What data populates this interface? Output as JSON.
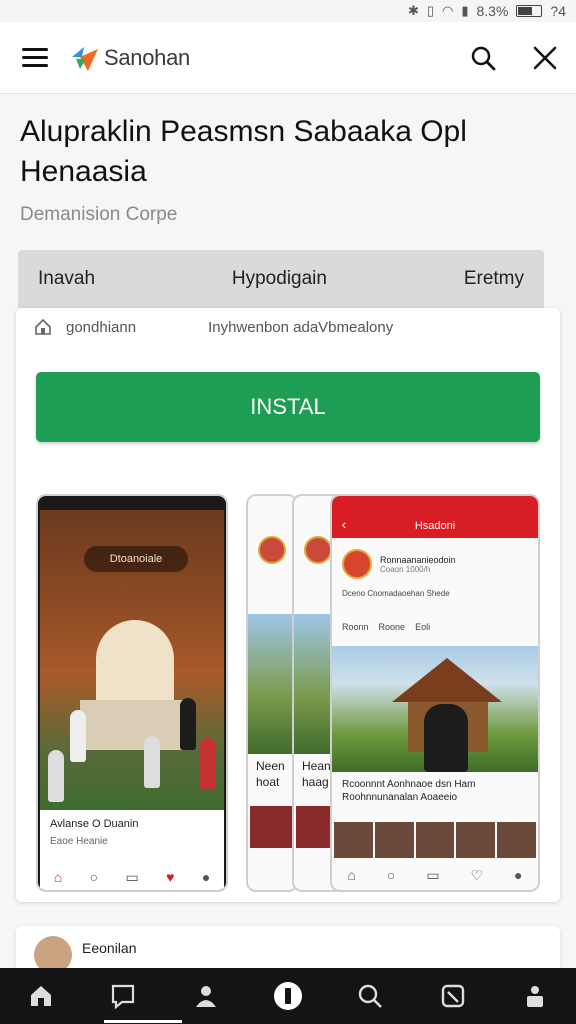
{
  "status_bar": {
    "battery": "8.3%",
    "time": "?4"
  },
  "header": {
    "brand": "Sanohan"
  },
  "app": {
    "title": "Alupraklin Peasmsn Sabaaka Opl Henaasia",
    "developer": "Demanision Corpe"
  },
  "tabs": [
    "Inavah",
    "Hypodigain",
    "Eretmy"
  ],
  "info": {
    "left": "gondhiann",
    "right": "Inyhwenbon adaVbmealony"
  },
  "install_label": "INSTAL",
  "screenshots": {
    "s1": {
      "badge": "Dtoanoiale",
      "caption": "Avlanse O Duanin",
      "sub": "Eaoe Heanie"
    },
    "s2": {
      "text": "Neen hoat"
    },
    "s3": {
      "text": "Hean haag"
    },
    "s4": {
      "header": "Hsadoni",
      "profile_name": "Ronnaananieodoin",
      "profile_sub": "Coaon 1000/h",
      "row2": "Dceno  Cnomadaoehan  Shede",
      "row3": [
        "Roonn",
        "Roone",
        "Eoli"
      ],
      "caption": "Rcoonnnt Aonhnaoe dsn Ham Roohnnunanalan Aoaeeio"
    }
  },
  "next_card": {
    "name": "Eeonilan"
  }
}
